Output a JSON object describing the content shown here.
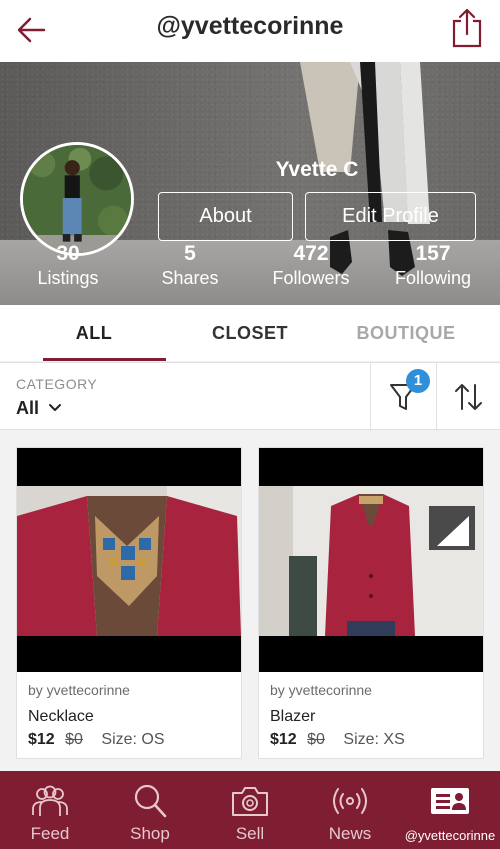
{
  "header": {
    "title": "@yvettecorinne"
  },
  "profile": {
    "name": "Yvette C",
    "about_label": "About",
    "edit_label": "Edit Profile",
    "stats": [
      {
        "num": "30",
        "label": "Listings"
      },
      {
        "num": "5",
        "label": "Shares"
      },
      {
        "num": "472",
        "label": "Followers"
      },
      {
        "num": "157",
        "label": "Following"
      }
    ]
  },
  "tabs": [
    {
      "label": "ALL",
      "active": true
    },
    {
      "label": "CLOSET",
      "active": false
    },
    {
      "label": "BOUTIQUE",
      "active": false
    }
  ],
  "filter": {
    "category_label": "CATEGORY",
    "category_value": "All",
    "filter_badge": "1"
  },
  "listings": [
    {
      "by": "by yvettecorinne",
      "title": "Necklace",
      "price": "$12",
      "original_price": "$0",
      "size": "Size: OS"
    },
    {
      "by": "by yvettecorinne",
      "title": "Blazer",
      "price": "$12",
      "original_price": "$0",
      "size": "Size: XS"
    }
  ],
  "nav": [
    {
      "label": "Feed",
      "icon": "people-icon"
    },
    {
      "label": "Shop",
      "icon": "search-icon"
    },
    {
      "label": "Sell",
      "icon": "camera-icon"
    },
    {
      "label": "News",
      "icon": "broadcast-icon"
    },
    {
      "label": "@yvettecorinne",
      "icon": "profile-card-icon",
      "active": true
    }
  ],
  "colors": {
    "brand": "#7f1d32",
    "badge": "#2f8fd8"
  }
}
